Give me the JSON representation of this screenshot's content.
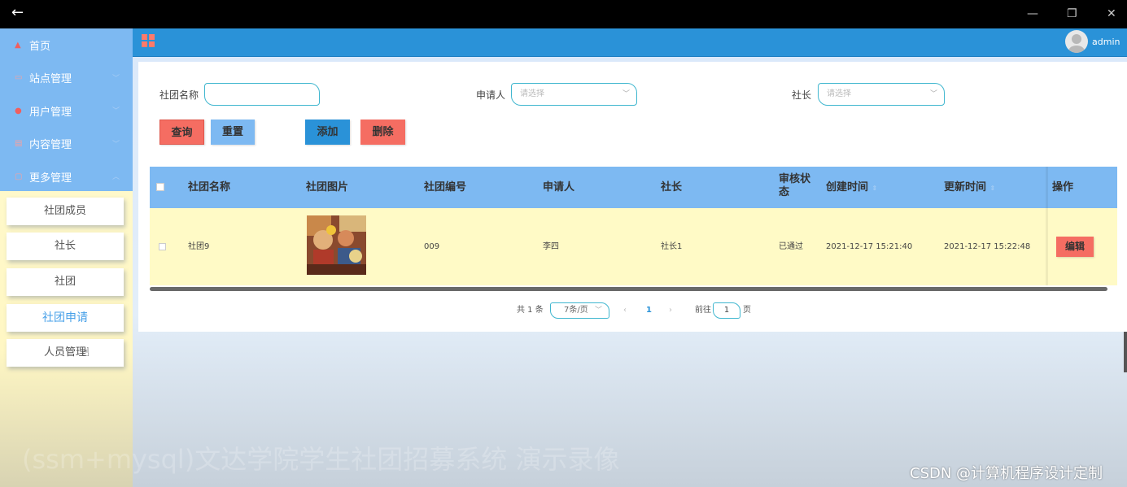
{
  "window": {
    "back_icon": "←",
    "minimize_icon": "—",
    "restore_icon": "❐",
    "close_icon": "✕"
  },
  "sidebar": {
    "menu": [
      {
        "label": "首页",
        "icon": "home-icon"
      },
      {
        "label": "站点管理",
        "icon": "monitor-icon"
      },
      {
        "label": "用户管理",
        "icon": "user-icon"
      },
      {
        "label": "内容管理",
        "icon": "document-icon"
      },
      {
        "label": "更多管理",
        "icon": "copy-icon"
      }
    ],
    "submenu": [
      "社团成员",
      "社长",
      "社团",
      "社团申请",
      "人员管理"
    ],
    "active_sub": "社团申请"
  },
  "header": {
    "username": "admin"
  },
  "search": {
    "club_name_label": "社团名称",
    "club_name_value": "",
    "applicant_label": "申请人",
    "applicant_placeholder": "请选择",
    "president_label": "社长",
    "president_placeholder": "请选择",
    "query_label": "查询",
    "reset_label": "重置",
    "add_label": "添加",
    "delete_label": "删除"
  },
  "table": {
    "columns": [
      "社团名称",
      "社团图片",
      "社团编号",
      "申请人",
      "社长",
      "审核状态",
      "创建时间",
      "更新时间",
      "操作"
    ],
    "rows": [
      {
        "club_name": "社团9",
        "club_number": "009",
        "applicant": "李四",
        "president": "社长1",
        "status": "已通过",
        "created": "2021-12-17 15:21:40",
        "updated": "2021-12-17 15:22:48",
        "action": "编辑"
      }
    ]
  },
  "pagination": {
    "total": "共 1 条",
    "page_size": "7条/页",
    "current_page": "1",
    "goto_label": "前往",
    "goto_value": "1",
    "page_suffix": "页"
  },
  "overlay": {
    "watermark": "(ssm+mysql)文达学院学生社团招募系统 演示录像",
    "credit": "CSDN @计算机程序设计定制"
  },
  "colors": {
    "nav_bg": "#7db9f2",
    "topbar": "#2a92d8",
    "danger": "#f56d62",
    "primary": "#2a92d8",
    "row_bg": "#fffac6"
  }
}
